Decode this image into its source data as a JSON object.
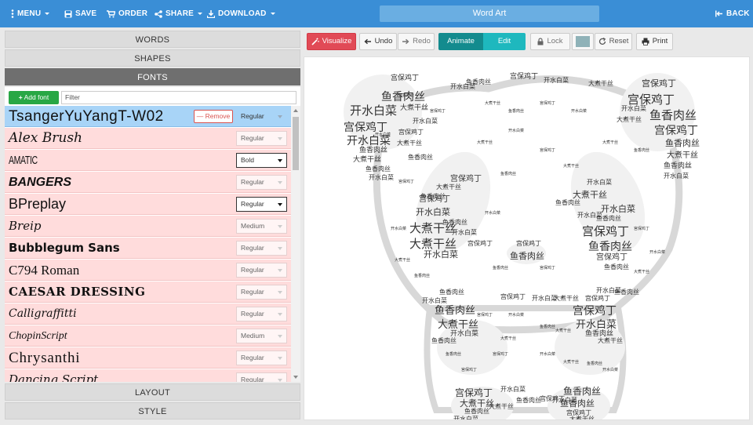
{
  "topbar": {
    "menu": "MENU",
    "save": "SAVE",
    "order": "ORDER",
    "share": "SHARE",
    "download": "DOWNLOAD",
    "title": "Word Art",
    "back": "BACK"
  },
  "sections": {
    "words": "WORDS",
    "shapes": "SHAPES",
    "fonts": "FONTS",
    "layout": "LAYOUT",
    "style": "STYLE"
  },
  "fonts_panel": {
    "add_font": "Add font",
    "filter_placeholder": "Filter",
    "remove": "Remove",
    "items": [
      {
        "name": "TsangerYuYangT-W02",
        "weight": "Regular"
      },
      {
        "name": "Alex Brush",
        "weight": "Regular"
      },
      {
        "name": "AMATIC",
        "weight": "Bold"
      },
      {
        "name": "BANGERS",
        "weight": "Regular"
      },
      {
        "name": "BPreplay",
        "weight": "Regular"
      },
      {
        "name": "Breip",
        "weight": "Medium"
      },
      {
        "name": "Bubblegum Sans",
        "weight": "Regular"
      },
      {
        "name": "C794 Roman",
        "weight": "Regular"
      },
      {
        "name": "CAESAR DRESSING",
        "weight": "Regular"
      },
      {
        "name": "Calligraffitti",
        "weight": "Regular"
      },
      {
        "name": "ChopinScript",
        "weight": "Medium"
      },
      {
        "name": "Chrysanthi",
        "weight": "Regular"
      },
      {
        "name": "Dancing Script",
        "weight": "Regular"
      }
    ]
  },
  "toolbar": {
    "visualize": "Visualize",
    "undo": "Undo",
    "redo": "Redo",
    "animate": "Animate",
    "edit": "Edit",
    "lock": "Lock",
    "reset": "Reset",
    "print": "Print",
    "color": "#8fb2b8"
  },
  "canvas": {
    "words": [
      "鱼香肉丝",
      "宫保鸡丁",
      "开水白菜",
      "大煮干丝"
    ],
    "word_color": "#333333"
  },
  "colors": {
    "topbar": "#3a8ed6",
    "visualize": "#e14a56",
    "animate": "#138b8e",
    "edit": "#1eb8be",
    "add_font": "#28a745",
    "row_bg": "#ffdcdc",
    "row_selected": "#a8d4f7"
  }
}
